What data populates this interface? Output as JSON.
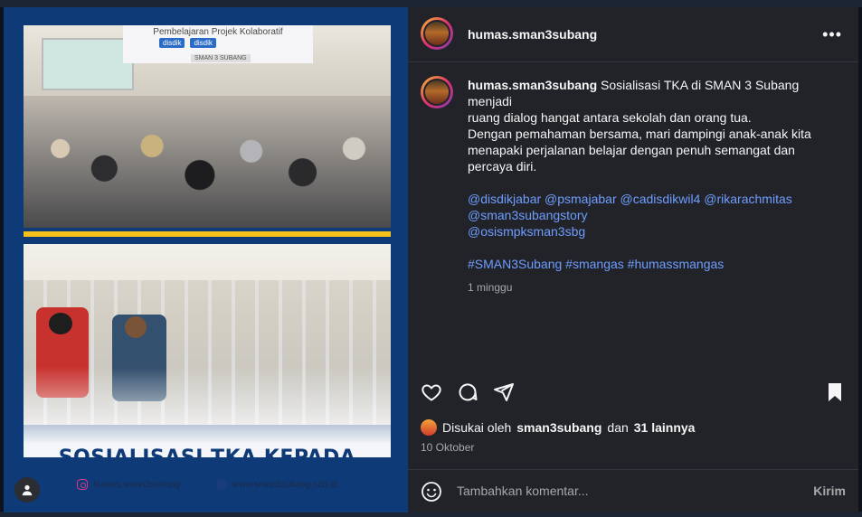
{
  "post": {
    "username": "humas.sman3subang",
    "more_label": "•••",
    "caption": {
      "line1": "Sosialisasi TKA di SMAN 3 Subang menjadi",
      "line2": "ruang dialog hangat antara sekolah dan orang tua.",
      "line3": "Dengan pemahaman bersama, mari dampingi anak-anak kita",
      "line4": "menapaki perjalanan belajar dengan penuh semangat dan",
      "line5": "percaya diri.",
      "mentions_line1": "@disdikjabar @psmajabar @cadisdikwil4 @rikarachmitas",
      "mentions_line2": "@sman3subangstory",
      "mentions_line3": "@osismpksman3sbg",
      "hashtags": "#SMAN3Subang #smangas #humassmangas"
    },
    "time_ago": "1 minggu",
    "likes": {
      "prefix": "Disukai oleh",
      "user": "sman3subang",
      "middle": "dan",
      "others": "31 lainnya"
    },
    "date": "10 Oktober",
    "comment_placeholder": "Tambahkan komentar...",
    "send_label": "Kirim"
  },
  "poster": {
    "banner_text": "Pembelajaran Projek Kolaboratif",
    "logo_text_1": "disdik",
    "logo_text_2": "disdik",
    "sub_banner": "SMAN 3 SUBANG",
    "title": "SOSIALISASI TKA KEPADA ORANG TUA MURID",
    "instagram_handle": "humas.sman3subang",
    "website": "www.sman3subang.sch.id"
  },
  "colors": {
    "panel_bg": "#212328",
    "link": "#6f9dff",
    "muted": "#a8a8a8",
    "poster_blue": "#0f3a78",
    "poster_yellow": "#f4c21a"
  },
  "icons": [
    "more-icon",
    "heart-icon",
    "comment-icon",
    "share-icon",
    "bookmark-icon",
    "emoji-icon",
    "user-tag-icon",
    "instagram-icon",
    "globe-icon"
  ]
}
